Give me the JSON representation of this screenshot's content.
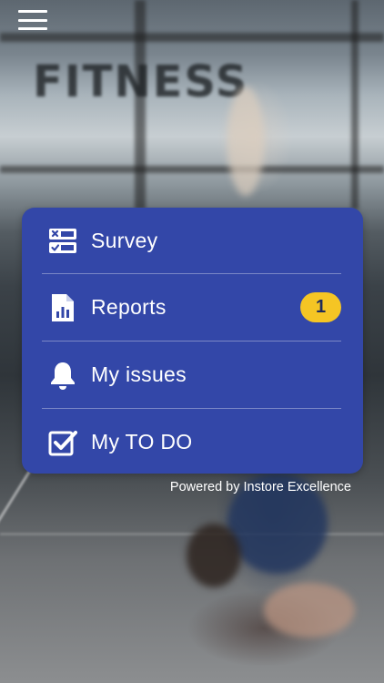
{
  "background": {
    "sign_text": "FITNESS"
  },
  "header": {
    "menu_icon": "hamburger-icon"
  },
  "menu": {
    "items": [
      {
        "label": "Survey",
        "icon": "survey-icon"
      },
      {
        "label": "Reports",
        "icon": "report-icon",
        "badge": "1"
      },
      {
        "label": "My issues",
        "icon": "bell-icon"
      },
      {
        "label": "My TO DO",
        "icon": "checkbox-icon"
      }
    ],
    "colors": {
      "panel": "#3347a8",
      "badge": "#f5c524"
    }
  },
  "footer": {
    "powered_by": "Powered by Instore Excellence"
  }
}
